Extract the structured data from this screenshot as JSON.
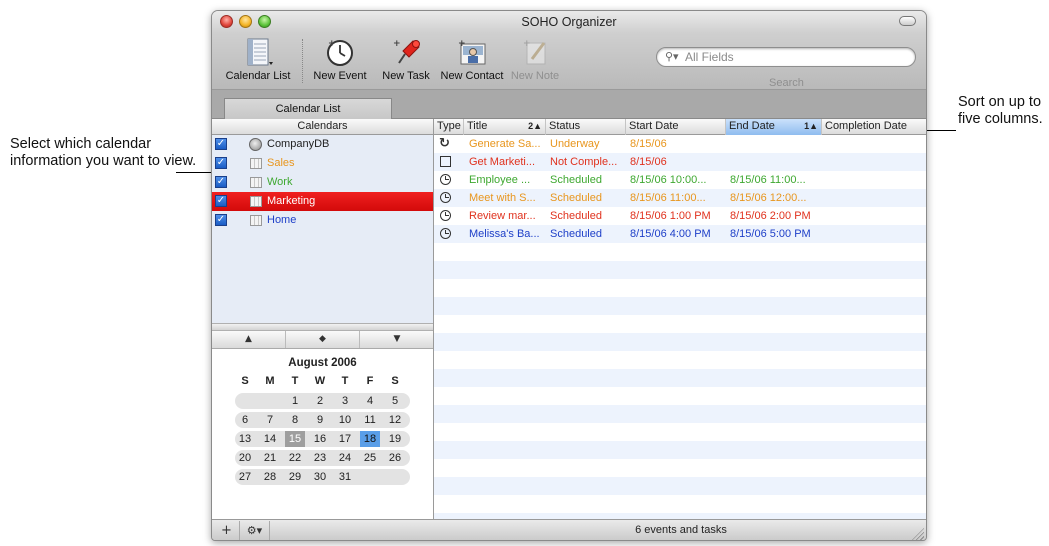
{
  "callouts": {
    "left_text": "Select which calendar information you want to view.",
    "right_text": "Sort on up to five columns."
  },
  "window": {
    "title": "SOHO Organizer"
  },
  "toolbar": {
    "calendar_list": "Calendar List",
    "new_event": "New Event",
    "new_task": "New Task",
    "new_contact": "New Contact",
    "new_note": "New Note",
    "search_placeholder": "All Fields",
    "search_label": "Search"
  },
  "tabs": {
    "calendar_list": "Calendar List"
  },
  "calendars": {
    "header": "Calendars",
    "items": [
      {
        "name": "CompanyDB",
        "color": "#222222",
        "checked": true
      },
      {
        "name": "Sales",
        "color": "#e8961e",
        "checked": true
      },
      {
        "name": "Work",
        "color": "#3ea830",
        "checked": true
      },
      {
        "name": "Marketing",
        "color": "#ffffff",
        "checked": true,
        "selected": true
      },
      {
        "name": "Home",
        "color": "#1e3fc8",
        "checked": true
      }
    ]
  },
  "mini_calendar": {
    "month": "August 2006",
    "dow": [
      "S",
      "M",
      "T",
      "W",
      "T",
      "F",
      "S"
    ],
    "weeks": [
      [
        "",
        "",
        "1",
        "2",
        "3",
        "4",
        "5"
      ],
      [
        "6",
        "7",
        "8",
        "9",
        "10",
        "11",
        "12"
      ],
      [
        "13",
        "14",
        "15",
        "16",
        "17",
        "18",
        "19"
      ],
      [
        "20",
        "21",
        "22",
        "23",
        "24",
        "25",
        "26"
      ],
      [
        "27",
        "28",
        "29",
        "30",
        "31",
        "",
        ""
      ]
    ],
    "today": "15",
    "selected": "18"
  },
  "table": {
    "columns": {
      "type": "Type",
      "title": "Title",
      "title_sort": "2▲",
      "status": "Status",
      "start": "Start Date",
      "end": "End Date",
      "end_sort": "1▲",
      "completion": "Completion Date"
    },
    "rows": [
      {
        "icon": "recur",
        "title": "Generate Sa...",
        "status": "Underway",
        "start": "8/15/06",
        "end": "",
        "color": "#e8961e"
      },
      {
        "icon": "task",
        "title": "Get Marketi...",
        "status": "Not Comple...",
        "start": "8/15/06",
        "end": "",
        "color": "#e0321e"
      },
      {
        "icon": "clock",
        "title": "Employee ...",
        "status": "Scheduled",
        "start": "8/15/06 10:00...",
        "end": "8/15/06 11:00...",
        "color": "#3ea830"
      },
      {
        "icon": "clock",
        "title": "Meet with S...",
        "status": "Scheduled",
        "start": "8/15/06 11:00...",
        "end": "8/15/06 12:00...",
        "color": "#e8961e"
      },
      {
        "icon": "clock",
        "title": "Review mar...",
        "status": "Scheduled",
        "start": "8/15/06 1:00 PM",
        "end": "8/15/06 2:00 PM",
        "color": "#e0321e"
      },
      {
        "icon": "clock",
        "title": "Melissa's Ba...",
        "status": "Scheduled",
        "start": "8/15/06 4:00 PM",
        "end": "8/15/06 5:00 PM",
        "color": "#1e3fc8"
      }
    ]
  },
  "status_bar": {
    "text": "6 events and tasks"
  }
}
